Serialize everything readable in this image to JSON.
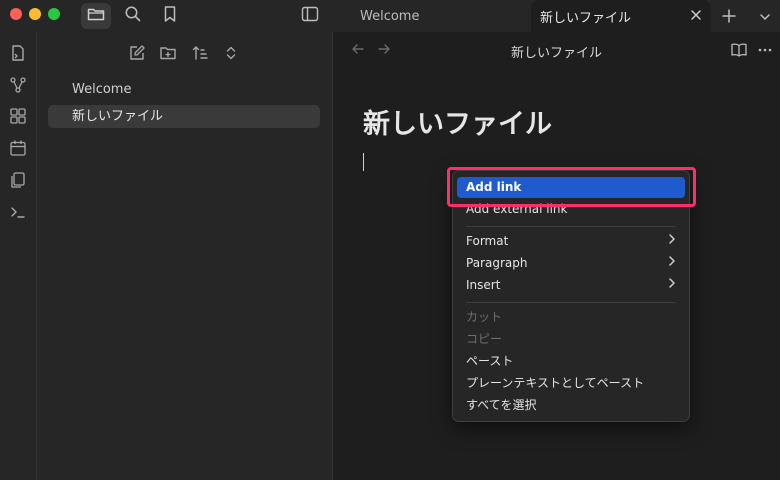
{
  "tabs": [
    {
      "label": "Welcome"
    },
    {
      "label": "新しいファイル"
    }
  ],
  "files": [
    {
      "label": "Welcome"
    },
    {
      "label": "新しいファイル"
    }
  ],
  "editor": {
    "view_title": "新しいファイル",
    "doc_title": "新しいファイル"
  },
  "context_menu": {
    "add_link": "Add link",
    "add_external_link": "Add external link",
    "format": "Format",
    "paragraph": "Paragraph",
    "insert": "Insert",
    "cut": "カット",
    "copy": "コピー",
    "paste": "ペースト",
    "paste_plain": "プレーンテキストとしてペースト",
    "select_all": "すべてを選択"
  },
  "icons": {
    "titlebar": [
      "folder-icon",
      "search-icon",
      "bookmark-icon",
      "sidebar-toggle-icon",
      "close-icon",
      "plus-icon",
      "chevron-down-icon"
    ],
    "ribbon": [
      "open-quick-switcher-icon",
      "graph-icon",
      "canvas-icon",
      "calendar-icon",
      "templates-icon",
      "terminal-icon"
    ],
    "sidebar_tools": [
      "new-note-icon",
      "new-folder-icon",
      "sort-icon",
      "collapse-icon"
    ],
    "editor": [
      "back-arrow-icon",
      "forward-arrow-icon",
      "reading-view-icon",
      "more-options-icon"
    ]
  },
  "colors": {
    "accent": "#1f5bcf",
    "highlight_box": "#ff2d6a",
    "traffic_red": "#fe5f57",
    "traffic_yellow": "#febc2e",
    "traffic_green": "#28c840"
  }
}
